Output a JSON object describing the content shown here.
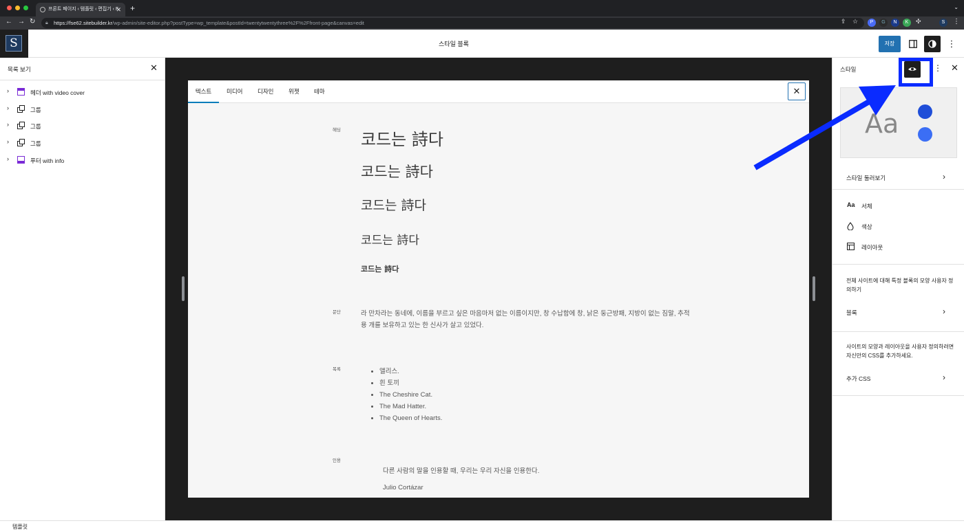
{
  "browser": {
    "tab_title": "프론트 페이지 ‹ 템플릿 ‹ 편집기 ‹ F",
    "url_domain": "https://fse62.sitebuilder.kr",
    "url_path": "/wp-admin/site-editor.php?postType=wp_template&postId=twentytwentythree%2F%2Ffront-page&canvas=edit",
    "extensions": [
      "P",
      "G",
      "N",
      "K",
      "S"
    ]
  },
  "header": {
    "site_letter": "S",
    "doc_title": "스타일 블록",
    "save_label": "저장"
  },
  "list_view": {
    "title": "목록 보기",
    "items": [
      {
        "label": "헤더 with video cover",
        "icon": "template-part-icon"
      },
      {
        "label": "그룹",
        "icon": "group-icon"
      },
      {
        "label": "그룹",
        "icon": "group-icon"
      },
      {
        "label": "그룹",
        "icon": "group-icon"
      },
      {
        "label": "푸터 with info",
        "icon": "template-part-icon"
      }
    ]
  },
  "style_book": {
    "tabs": [
      "텍스트",
      "미디어",
      "디자인",
      "위젯",
      "테마"
    ],
    "heading_label": "헤딩",
    "headings": [
      "코드는 詩다",
      "코드는 詩다",
      "코드는 詩다",
      "코드는 詩다",
      "코드는 詩다"
    ],
    "paragraph_label": "문단",
    "paragraph": "라 만차라는 동네에, 이름을 부르고 싶은 마음마저 없는 이름이지만, 창 수납함에 창, 낡은 둥근방패, 지방이 없는 짐말, 추적용 개를 보유하고 있는 한 신사가 살고 있었다.",
    "list_label": "목록",
    "list_items": [
      "앨리스.",
      "흰 토끼",
      "The Cheshire Cat.",
      "The Mad Hatter.",
      "The Queen of Hearts."
    ],
    "quote_label": "인용",
    "quote_text": "다른 사람의 말을 인용할 때, 우리는 우리 자신을 인용한다.",
    "quote_cite": "Julio Cortázar"
  },
  "styles_panel": {
    "title": "스타일",
    "browse_label": "스타일 둘러보기",
    "typography_label": "서체",
    "colors_label": "색상",
    "layout_label": "레이아웃",
    "blocks_desc": "전체 사이트에 대해 특정 블록의 모양 사용자 정의하기",
    "blocks_label": "블록",
    "css_desc": "사이트의 모양과 레이아웃을 사용자 정의하려면 자신만의 CSS를 추가하세요.",
    "css_label": "추가 CSS",
    "preview_text": "Aa",
    "preview_dot_colors": [
      "#1f4ed8",
      "#3b6ef5"
    ]
  },
  "footer": {
    "label": "템플릿"
  },
  "colors": {
    "accent": "#2271b1",
    "highlight": "#0a2bff"
  }
}
